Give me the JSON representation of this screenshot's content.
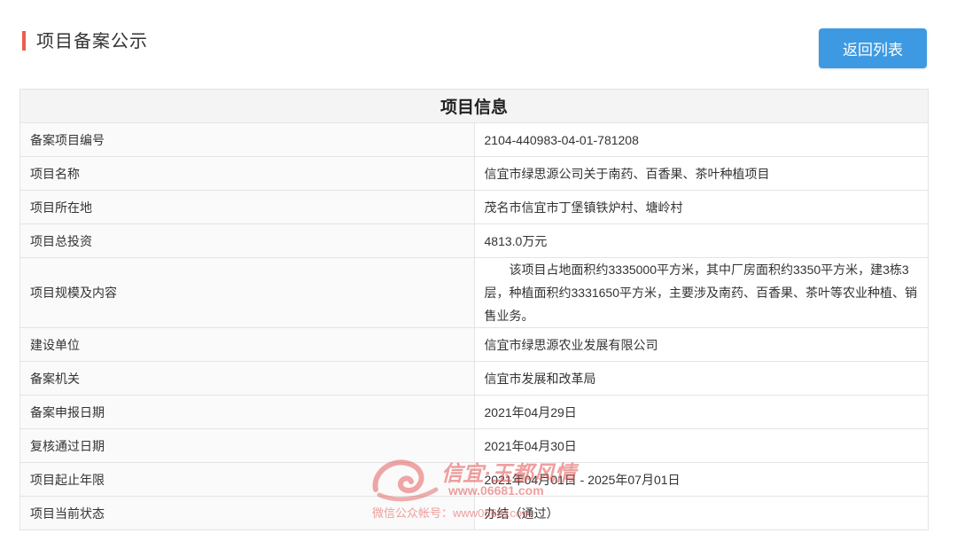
{
  "header": {
    "title": "项目备案公示",
    "back_button_label": "返回列表"
  },
  "table": {
    "heading": "项目信息",
    "rows": [
      {
        "label": "备案项目编号",
        "value": "2104-440983-04-01-781208"
      },
      {
        "label": "项目名称",
        "value": "信宜市绿思源公司关于南药、百香果、茶叶种植项目"
      },
      {
        "label": "项目所在地",
        "value": "茂名市信宜市丁堡镇铁炉村、塘岭村"
      },
      {
        "label": "项目总投资",
        "value": "4813.0万元"
      },
      {
        "label": "项目规模及内容",
        "value": "该项目占地面积约3335000平方米，其中厂房面积约3350平方米，建3栋3层，种植面积约3331650平方米，主要涉及南药、百香果、茶叶等农业种植、销售业务。"
      },
      {
        "label": "建设单位",
        "value": "信宜市绿思源农业发展有限公司"
      },
      {
        "label": "备案机关",
        "value": "信宜市发展和改革局"
      },
      {
        "label": "备案申报日期",
        "value": "2021年04月29日"
      },
      {
        "label": "复核通过日期",
        "value": "2021年04月30日"
      },
      {
        "label": "项目起止年限",
        "value": "2021年04月01日 - 2025年07月01日"
      },
      {
        "label": "项目当前状态",
        "value": "办结（通过）"
      }
    ]
  },
  "watermark": {
    "title": "信宜·玉都风情",
    "url": "www.06681.com",
    "wechat": "微信公众帐号：www06681com"
  },
  "colors": {
    "accent_bar": "#e8604c",
    "button": "#3d9ae2",
    "watermark": "#e15050"
  }
}
